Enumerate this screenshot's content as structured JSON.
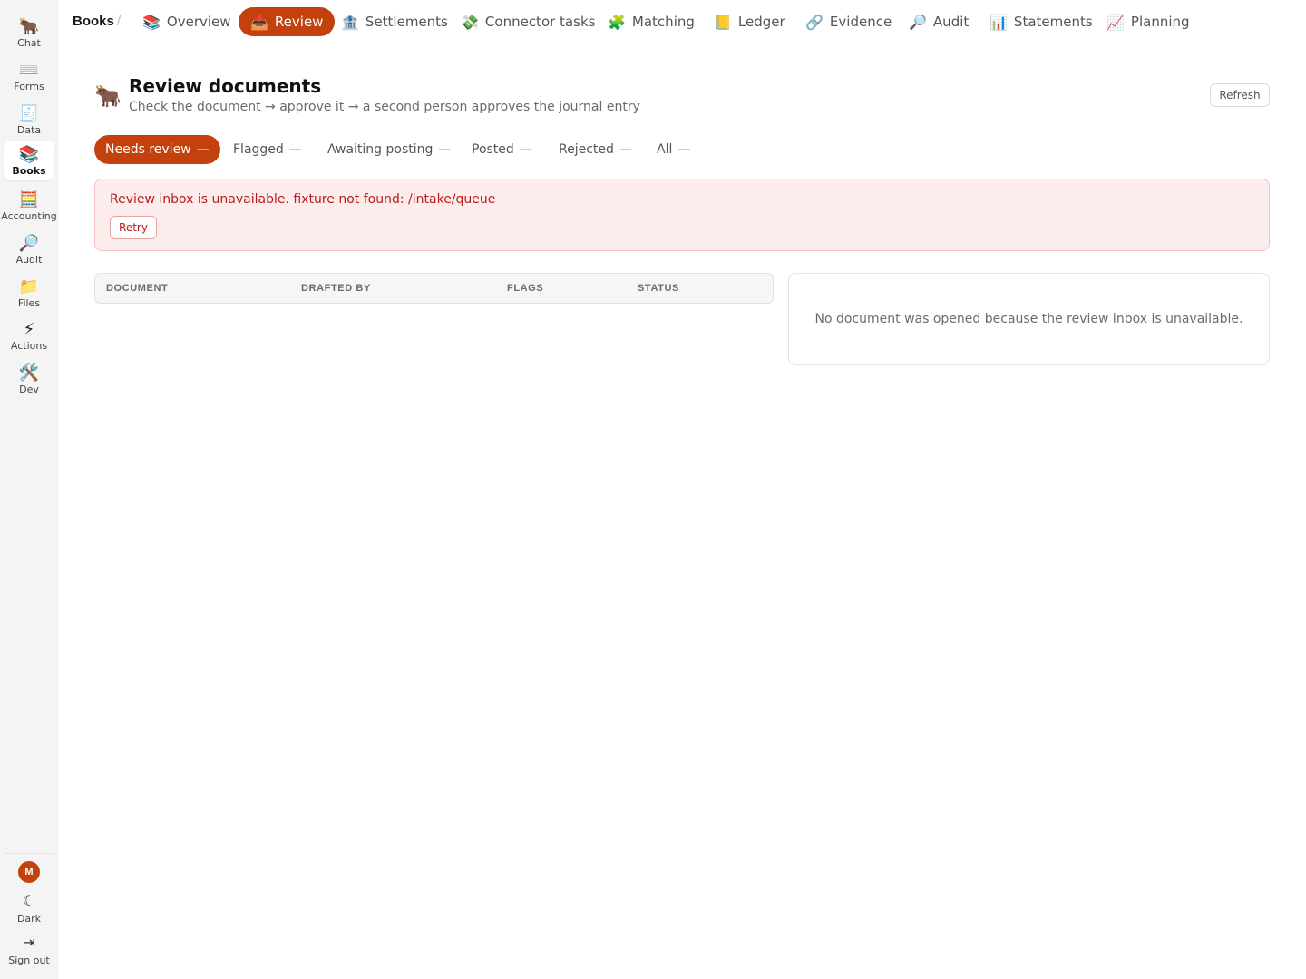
{
  "sidebar": {
    "items": [
      {
        "label": "Chat",
        "icon": "🐂"
      },
      {
        "label": "Forms",
        "icon": "⌨️"
      },
      {
        "label": "Data",
        "icon": "🧾"
      },
      {
        "label": "Books",
        "icon": "📚"
      },
      {
        "label": "Accounting",
        "icon": "🧮"
      },
      {
        "label": "Audit",
        "icon": "🔎"
      },
      {
        "label": "Files",
        "icon": "📁"
      },
      {
        "label": "Actions",
        "icon": "⚡"
      },
      {
        "label": "Dev",
        "icon": "🛠️"
      }
    ],
    "active": "Books",
    "avatar_initial": "M",
    "dark_label": "Dark",
    "dark_icon": "☾",
    "signout_label": "Sign out",
    "signout_icon": "⇥"
  },
  "topnav": {
    "breadcrumb": "Books",
    "separator": "/",
    "tabs": [
      {
        "label": "Overview",
        "icon": "📚"
      },
      {
        "label": "Review",
        "icon": "📥"
      },
      {
        "label": "Settlements",
        "icon": "🏦"
      },
      {
        "label": "Connector tasks",
        "icon": "💸"
      },
      {
        "label": "Matching",
        "icon": "🧩"
      },
      {
        "label": "Ledger",
        "icon": "📒"
      },
      {
        "label": "Evidence",
        "icon": "🔗"
      },
      {
        "label": "Audit",
        "icon": "🔎"
      },
      {
        "label": "Statements",
        "icon": "📊"
      },
      {
        "label": "Planning",
        "icon": "📈"
      }
    ],
    "active_tab": "Review"
  },
  "header": {
    "icon": "🐂",
    "title": "Review documents",
    "subtitle": "Check the document → approve it → a second person approves the journal entry",
    "refresh_label": "Refresh"
  },
  "filters": [
    {
      "label": "Needs review",
      "count": "—"
    },
    {
      "label": "Flagged",
      "count": "—"
    },
    {
      "label": "Awaiting posting",
      "count": "—"
    },
    {
      "label": "Posted",
      "count": "—"
    },
    {
      "label": "Rejected",
      "count": "—"
    },
    {
      "label": "All",
      "count": "—"
    }
  ],
  "error": {
    "message": "Review inbox is unavailable. fixture not found: /intake/queue",
    "retry_label": "Retry"
  },
  "table": {
    "columns": [
      "DOCUMENT",
      "DRAFTED BY",
      "FLAGS",
      "STATUS"
    ]
  },
  "detail": {
    "message": "No document was opened because the review inbox is unavailable."
  },
  "colors": {
    "accent": "#c2410c",
    "error_bg": "#fdecec",
    "error_text": "#b91c1c"
  }
}
